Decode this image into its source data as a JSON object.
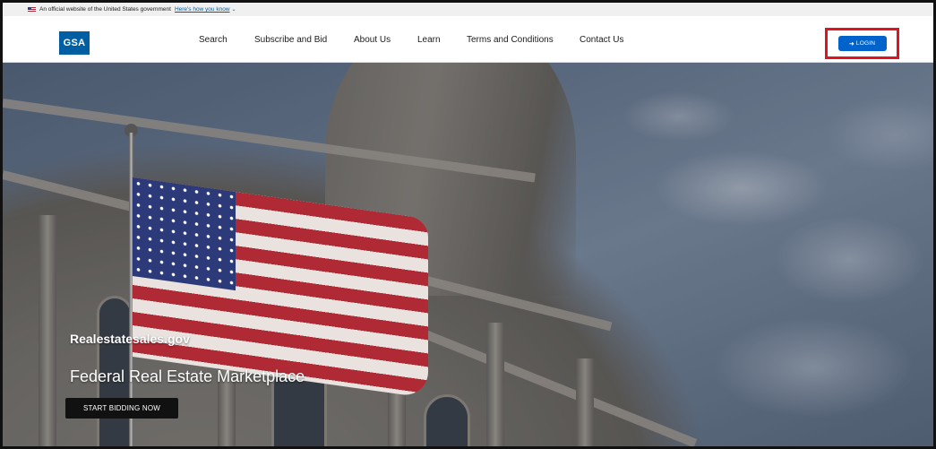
{
  "gov_banner": {
    "text": "An official website of the United States government",
    "link": "Here's how you know",
    "chevron_icon": "chevron-down-icon"
  },
  "header": {
    "logo_text": "GSA",
    "nav": [
      {
        "label": "Search"
      },
      {
        "label": "Subscribe and Bid"
      },
      {
        "label": "About Us"
      },
      {
        "label": "Learn"
      },
      {
        "label": "Terms and Conditions"
      },
      {
        "label": "Contact Us"
      }
    ],
    "login": {
      "label": "LOGIN",
      "icon": "login-arrow-icon"
    }
  },
  "hero": {
    "site_name": "Realestatesales.gov",
    "title": "Federal Real Estate Marketplace",
    "cta_label": "START BIDDING NOW"
  },
  "colors": {
    "brand_blue": "#005ea2",
    "login_blue": "#0063cc",
    "highlight_red": "#e0141e",
    "cta_black": "#111111"
  }
}
